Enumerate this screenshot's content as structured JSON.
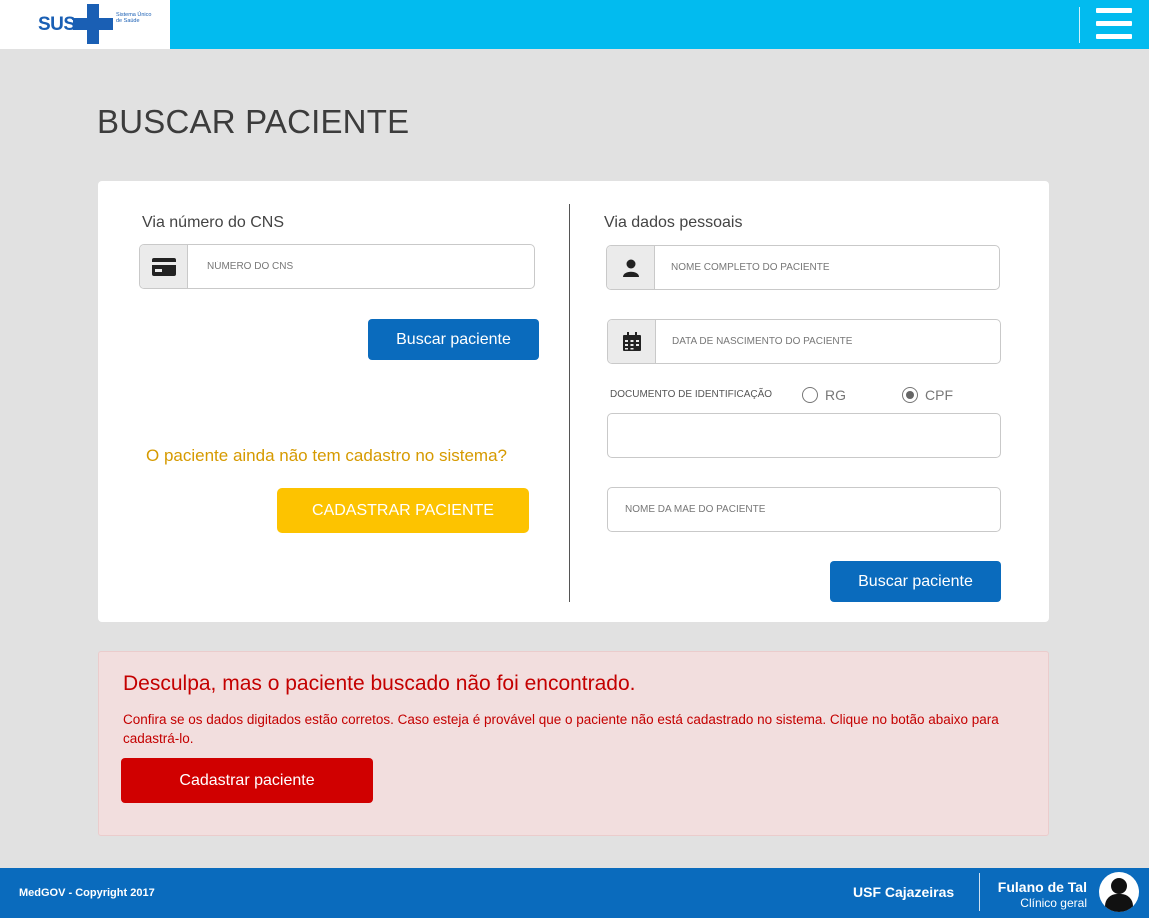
{
  "header": {
    "logo_text": "SUS",
    "logo_subtext": "Sistema Único de Saúde",
    "bg_color": "#02bbef"
  },
  "page": {
    "title": "BUSCAR PACIENTE"
  },
  "cns_section": {
    "title": "Via número do CNS",
    "cns_placeholder": "NÚMERO DO CNS",
    "search_label": "Buscar paciente",
    "no_record_question": "O paciente ainda não tem cadastro no sistema?",
    "register_label": "CADASTRAR PACIENTE"
  },
  "personal_section": {
    "title": "Via dados pessoais",
    "name_placeholder": "NOME COMPLETO DO PACIENTE",
    "birth_placeholder": "DATA DE NASCIMENTO DO PACIENTE",
    "doc_label": "DOCUMENTO DE IDENTIFICAÇÃO",
    "doc_options": [
      "RG",
      "CPF"
    ],
    "doc_selected": "CPF",
    "doc_value": "",
    "mother_placeholder": "NOME DA MÃE DO PACIENTE",
    "search_label": "Buscar paciente"
  },
  "error": {
    "title": "Desculpa, mas o paciente buscado não foi encontrado.",
    "message": "Confira se os dados digitados estão corretos. Caso esteja é provável que o paciente não está cadastrado no sistema. Clique no botão abaixo para cadastrá-lo.",
    "button_label": "Cadastrar paciente"
  },
  "footer": {
    "copyright": "MedGOV - Copyright 2017",
    "unit": "USF Cajazeiras",
    "user_name": "Fulano de Tal",
    "user_role": "Clínico geral"
  },
  "colors": {
    "primary": "#0a6bbd",
    "warning": "#fdc300",
    "danger": "#d00000",
    "header": "#02bbef"
  }
}
